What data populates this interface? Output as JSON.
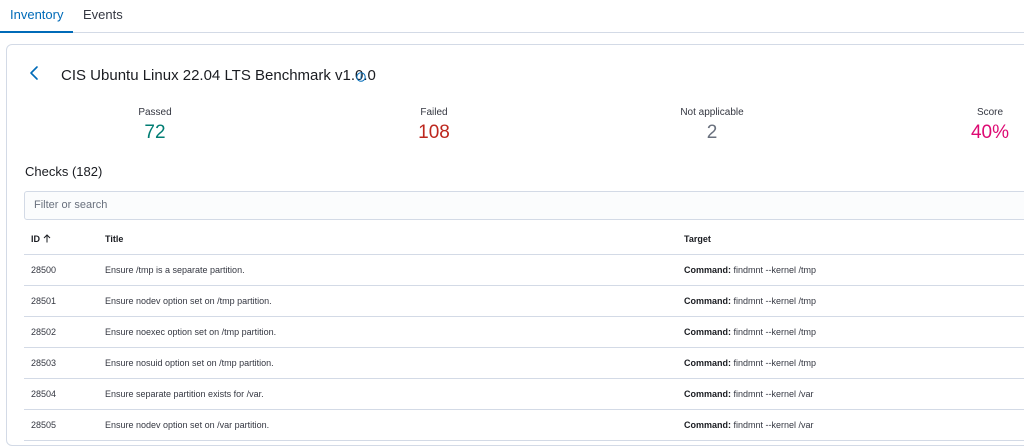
{
  "tabs": [
    {
      "label": "Inventory",
      "active": true
    },
    {
      "label": "Events",
      "active": false
    }
  ],
  "header": {
    "title": "CIS Ubuntu Linux 22.04 LTS Benchmark v1.0.0"
  },
  "stats": {
    "passed": {
      "label": "Passed",
      "value": "72",
      "color": "#017d73"
    },
    "failed": {
      "label": "Failed",
      "value": "108",
      "color": "#bd271e"
    },
    "not_applicable": {
      "label": "Not applicable",
      "value": "2",
      "color": "#69707d"
    },
    "score": {
      "label": "Score",
      "value": "40%",
      "color": "#dd0a73"
    }
  },
  "checks": {
    "heading": "Checks (182)",
    "search_placeholder": "Filter or search",
    "columns": {
      "id": "ID",
      "title": "Title",
      "target": "Target"
    },
    "target_prefix": "Command:",
    "rows": [
      {
        "id": "28500",
        "title": "Ensure /tmp is a separate partition.",
        "target": "findmnt --kernel /tmp"
      },
      {
        "id": "28501",
        "title": "Ensure nodev option set on /tmp partition.",
        "target": "findmnt --kernel /tmp"
      },
      {
        "id": "28502",
        "title": "Ensure noexec option set on /tmp partition.",
        "target": "findmnt --kernel /tmp"
      },
      {
        "id": "28503",
        "title": "Ensure nosuid option set on /tmp partition.",
        "target": "findmnt --kernel /tmp"
      },
      {
        "id": "28504",
        "title": "Ensure separate partition exists for /var.",
        "target": "findmnt --kernel /var"
      },
      {
        "id": "28505",
        "title": "Ensure nodev option set on /var partition.",
        "target": "findmnt --kernel /var"
      }
    ]
  }
}
